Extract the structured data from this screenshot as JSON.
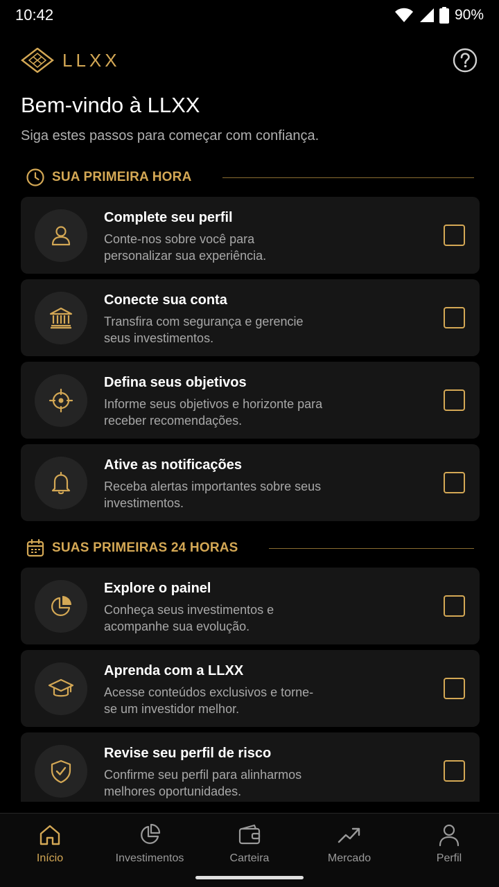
{
  "status_bar": {
    "time": "10:42",
    "battery": "90%"
  },
  "header": {
    "logo_text": "LLXX",
    "logo_icon": "diamond-logo-icon",
    "help_icon": "help-circle-icon"
  },
  "welcome": {
    "title": "Bem-vindo à LLXX",
    "subtitle": "Siga estes passos para começar com confiança."
  },
  "sections": [
    {
      "label": "SUA PRIMEIRA HORA",
      "icon": "clock-icon",
      "items": [
        {
          "title": "Complete seu perfil",
          "description": "Conte-nos sobre você para personalizar sua experiência.",
          "icon": "user-icon",
          "checked": false
        },
        {
          "title": "Conecte sua conta",
          "description": "Transfira com segurança e gerencie seus investimentos.",
          "icon": "bank-icon",
          "checked": false
        },
        {
          "title": "Defina seus objetivos",
          "description": "Informe seus objetivos e horizonte para receber recomendações.",
          "icon": "target-icon",
          "checked": false
        },
        {
          "title": "Ative as notificações",
          "description": "Receba alertas importantes sobre seus investimentos.",
          "icon": "bell-icon",
          "checked": false
        }
      ]
    },
    {
      "label": "SUAS PRIMEIRAS 24 HORAS",
      "icon": "calendar-icon",
      "items": [
        {
          "title": "Explore o painel",
          "description": "Conheça seus investimentos e acompanhe sua evolução.",
          "icon": "pie-chart-icon",
          "checked": false
        },
        {
          "title": "Aprenda com a LLXX",
          "description": "Acesse conteúdos exclusivos e torne-se um investidor melhor.",
          "icon": "graduation-cap-icon",
          "checked": false
        },
        {
          "title": "Revise seu perfil de risco",
          "description": "Confirme seu perfil para alinharmos melhores oportunidades.",
          "icon": "shield-icon",
          "checked": false
        }
      ]
    }
  ],
  "nav": [
    {
      "label": "Início",
      "icon": "home-icon",
      "active": true
    },
    {
      "label": "Investimentos",
      "icon": "pie-chart-icon",
      "active": false
    },
    {
      "label": "Carteira",
      "icon": "wallet-icon",
      "active": false
    },
    {
      "label": "Mercado",
      "icon": "trend-icon",
      "active": false
    },
    {
      "label": "Perfil",
      "icon": "user-icon",
      "active": false
    }
  ],
  "colors": {
    "accent": "#D4A855",
    "background": "#000000",
    "card": "#161616",
    "icon_circle": "#242424",
    "muted_text": "#a8a8a8"
  }
}
